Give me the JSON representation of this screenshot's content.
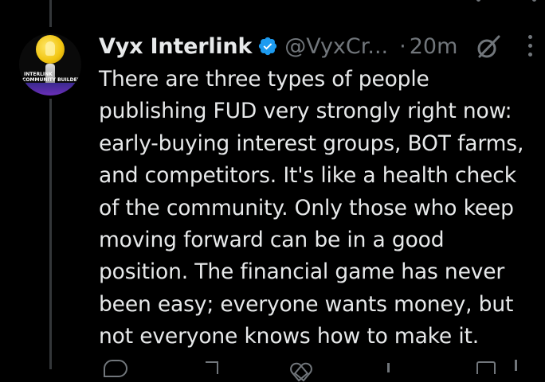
{
  "post": {
    "author_name": "Vyx Interlink",
    "handle": "@VyxCr...",
    "separator": "·",
    "timestamp": "20m",
    "text": "There are three types of people\npublishing FUD very strongly right now:\nearly-buying interest groups, BOT farms,\nand competitors. It's like a health check\nof the community. Only those who keep\nmoving forward can be in a good\nposition. The financial game has never\nbeen easy; everyone wants money, but\nnot everyone knows how to make it."
  },
  "avatar": {
    "line1": "INTERLINK",
    "line2": "COMMUNITY BUILDER"
  },
  "icons": {
    "verified": "verified-badge-icon",
    "grok": "grok-icon",
    "more": "more-options-icon",
    "reply": "reply-icon",
    "repost": "repost-icon",
    "like": "like-icon",
    "views": "views-icon",
    "bookmark": "bookmark-icon",
    "share": "share-icon"
  },
  "colors": {
    "background": "#000000",
    "text_primary": "#e7e9ea",
    "text_secondary": "#71767b",
    "verified_blue": "#1d9bf0"
  }
}
